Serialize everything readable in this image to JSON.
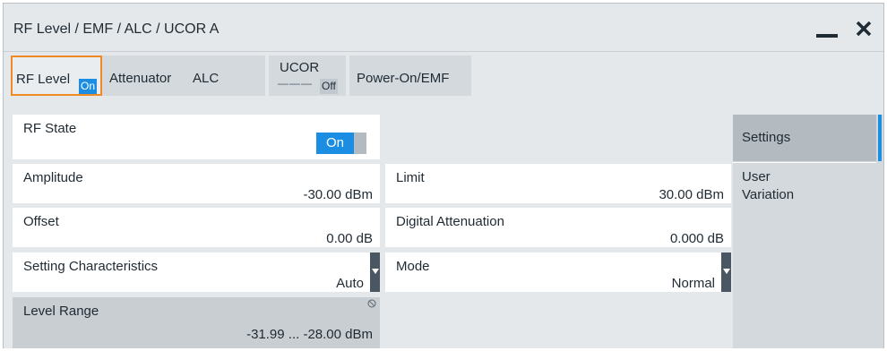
{
  "window": {
    "title": "RF Level / EMF / ALC / UCOR A",
    "minimize_icon": "minimize-icon",
    "close_icon": "close-icon"
  },
  "tabs": [
    {
      "label": "RF Level",
      "badge": "On",
      "active": true
    },
    {
      "label": "Attenuator"
    },
    {
      "label": "ALC"
    },
    {
      "label": "UCOR",
      "sub": "———",
      "badge": "Off"
    },
    {
      "label": "Power-On/EMF"
    }
  ],
  "fields": {
    "rf_state": {
      "label": "RF State",
      "value": "On"
    },
    "amplitude": {
      "label": "Amplitude",
      "value": "-30.00 dBm"
    },
    "offset": {
      "label": "Offset",
      "value": "0.00 dB"
    },
    "setting_characteristics": {
      "label": "Setting Characteristics",
      "value": "Auto"
    },
    "level_range": {
      "label": "Level Range",
      "value": "-31.99 ... -28.00 dBm"
    },
    "limit": {
      "label": "Limit",
      "value": "30.00 dBm"
    },
    "digital_attenuation": {
      "label": "Digital Attenuation",
      "value": "0.000 dB"
    },
    "mode": {
      "label": "Mode",
      "value": "Normal"
    }
  },
  "side_menu": [
    {
      "label": "Settings",
      "active": true
    },
    {
      "label": "User Variation"
    }
  ],
  "colors": {
    "accent": "#1b8ee4",
    "tab_highlight": "#f08a24",
    "panel_bg": "#e4e8eb"
  }
}
